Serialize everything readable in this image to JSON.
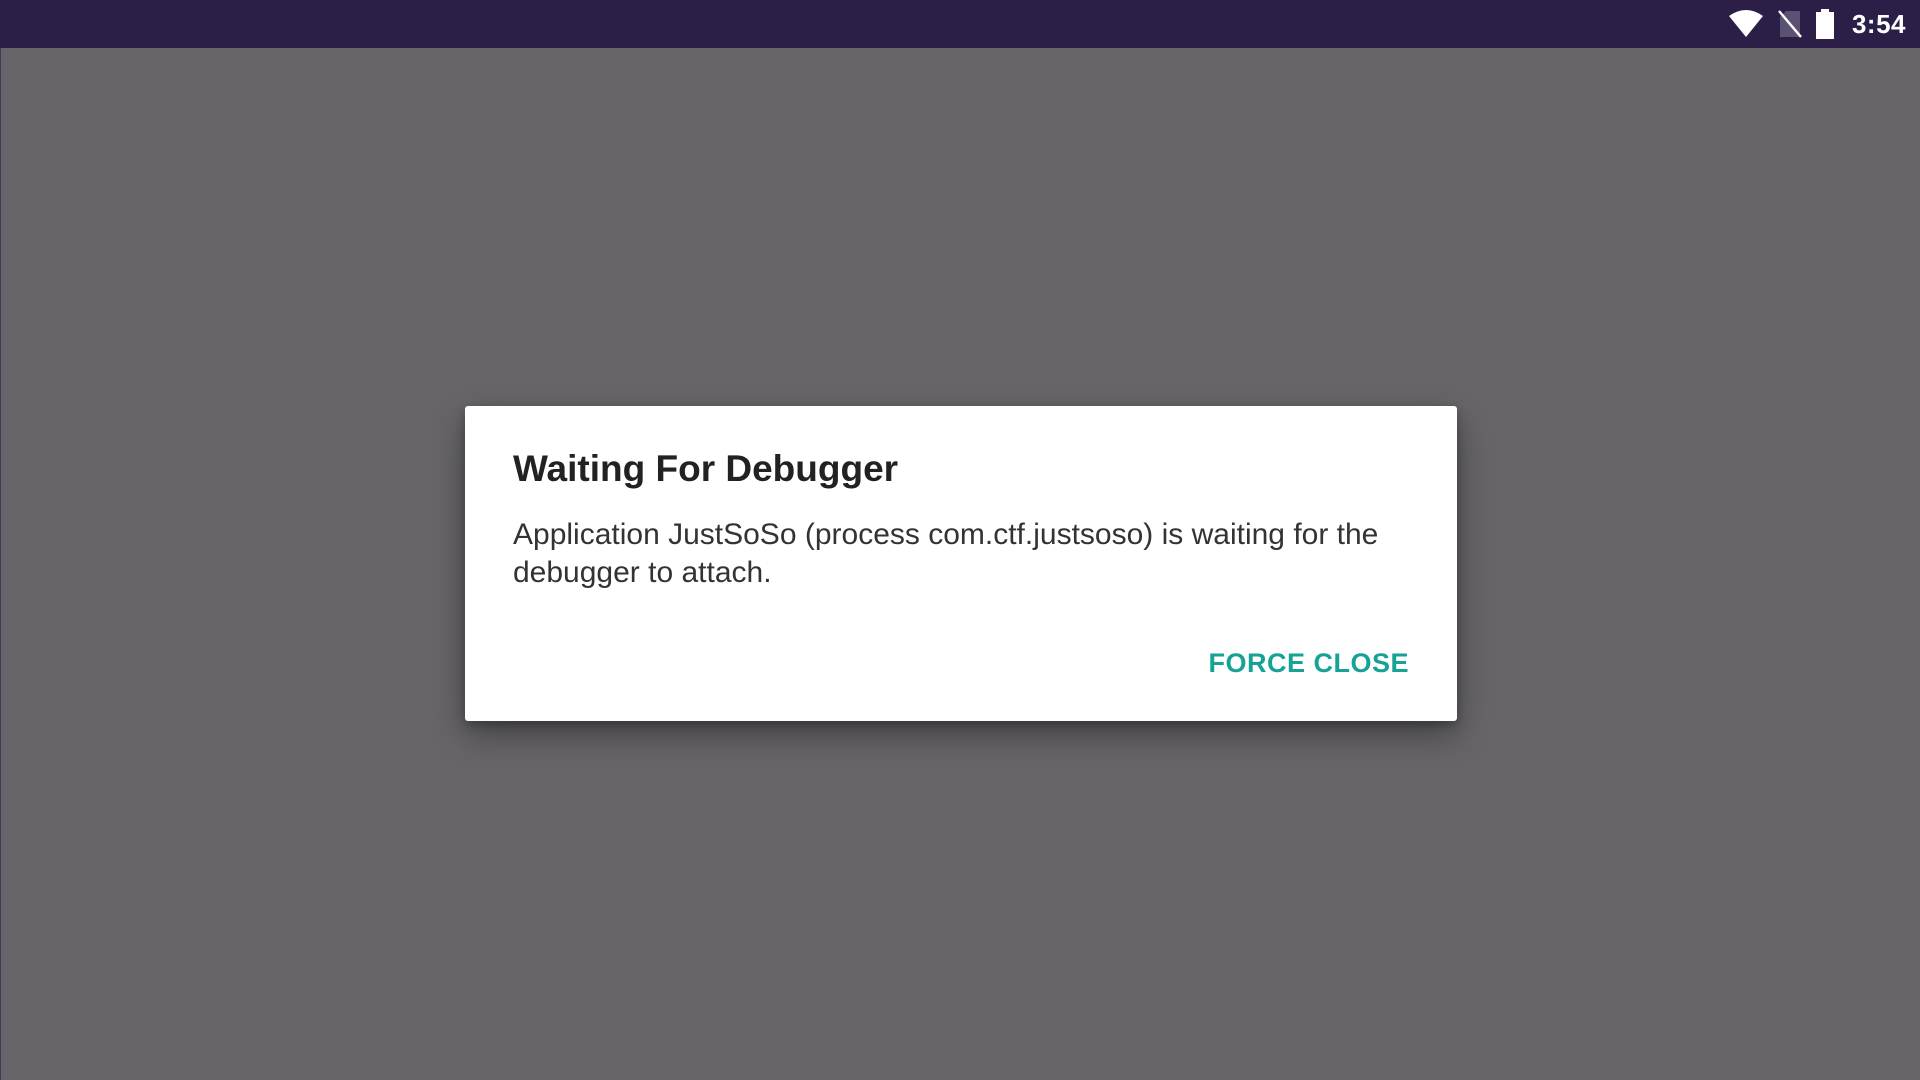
{
  "status_bar": {
    "time": "3:54",
    "icons": [
      "wifi-icon",
      "no-sim-icon",
      "battery-icon"
    ]
  },
  "dialog": {
    "title": "Waiting For Debugger",
    "message": "Application JustSoSo (process com.ctf.justsoso) is waiting for the debugger to attach.",
    "buttons": {
      "force_close": "FORCE CLOSE"
    }
  },
  "colors": {
    "status_bar_bg": "#2b1f47",
    "scrim_bg": "#676569",
    "dialog_bg": "#ffffff",
    "accent": "#16a294"
  }
}
